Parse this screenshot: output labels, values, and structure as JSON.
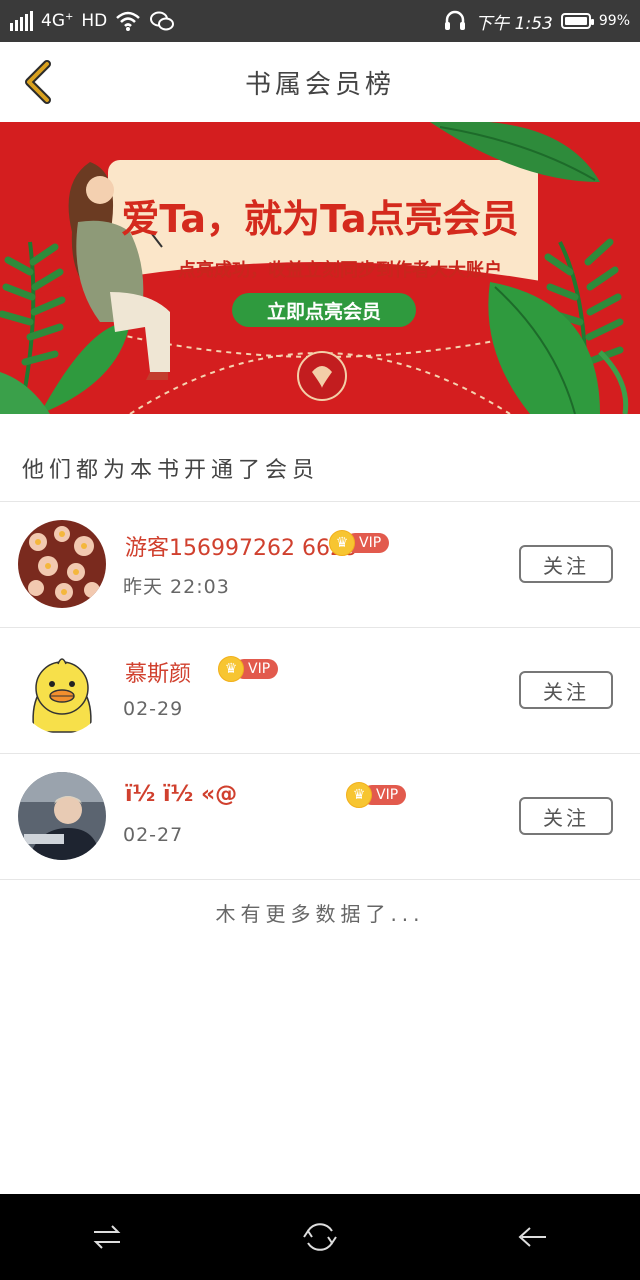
{
  "status_bar": {
    "network": "4G",
    "network_sup": "+",
    "hd": "HD",
    "time": "下午 1:53",
    "battery": "99%",
    "battery_level": 0.99
  },
  "nav": {
    "title": "书属会员榜"
  },
  "banner": {
    "title": "爱Ta，就为Ta点亮会员",
    "subtitle": "点亮成功，收益立刻同步到作者大大账户",
    "button": "立即点亮会员"
  },
  "section": {
    "header": "他们都为本书开通了会员"
  },
  "members": [
    {
      "name": "游客156997262 6629",
      "vip": "VIP",
      "date": "昨天 22:03",
      "follow": "关注"
    },
    {
      "name": "慕斯颜",
      "vip": "VIP",
      "date": "02-29",
      "follow": "关注"
    },
    {
      "name": "ï½ ï½ «@",
      "vip": "VIP",
      "date": "02-27",
      "follow": "关注"
    }
  ],
  "footer": {
    "no_more": "木有更多数据了..."
  }
}
